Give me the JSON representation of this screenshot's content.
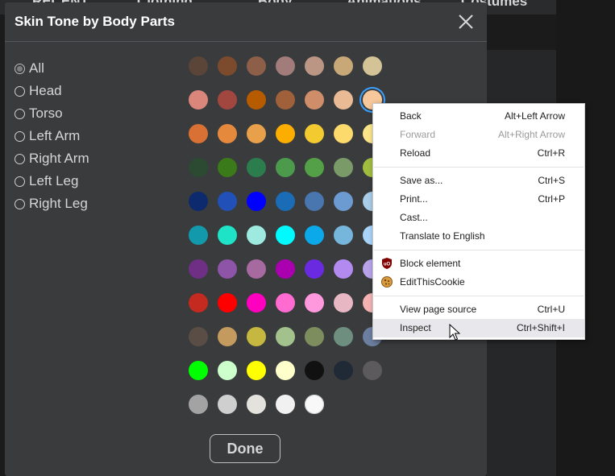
{
  "background_nav": {
    "items": [
      "RECENT",
      "Clothing",
      "Body",
      "Animations",
      "Costumes"
    ]
  },
  "modal": {
    "title": "Skin Tone by Body Parts",
    "close_icon": "close-icon",
    "radio_options": [
      {
        "label": "All",
        "checked": true
      },
      {
        "label": "Head",
        "checked": false
      },
      {
        "label": "Torso",
        "checked": false
      },
      {
        "label": "Left Arm",
        "checked": false
      },
      {
        "label": "Right Arm",
        "checked": false
      },
      {
        "label": "Left Leg",
        "checked": false
      },
      {
        "label": "Right Leg",
        "checked": false
      }
    ],
    "swatch_rows": [
      [
        "#5a4538",
        "#7c4a2d",
        "#8d5f48",
        "#a17c7a",
        "#bc9684",
        "#c9a877",
        "#d3c396"
      ],
      [
        "#da867a",
        "#a2473f",
        "#b65b00",
        "#a0603a",
        "#cf8d69",
        "#eaba94",
        "#f6c89b"
      ],
      [
        "#d97034",
        "#e58a3d",
        "#e8a04a",
        "#fcae00",
        "#f3cb31",
        "#fcda6b",
        "#fbe589"
      ],
      [
        "#2b4a31",
        "#3a7a19",
        "#2b7d4e",
        "#4c9a4c",
        "#54a047",
        "#7a9a68",
        "#a1bd40"
      ],
      [
        "#0e2a6e",
        "#2050b8",
        "#0000ff",
        "#1b6cb7",
        "#4a76b0",
        "#6c9bd2",
        "#a9cce8"
      ],
      [
        "#1299ac",
        "#1fe3c7",
        "#9ee9e0",
        "#00fbff",
        "#0ba9ea",
        "#76b6dc",
        "#a9d3f9"
      ],
      [
        "#6e2f85",
        "#8e54a8",
        "#a76aa0",
        "#ab00b0",
        "#6a2be0",
        "#b28af0",
        "#b8a3e8"
      ],
      [
        "#c42a1f",
        "#ff0000",
        "#ff00bf",
        "#ff6bd1",
        "#ff98dc",
        "#e7b8c4",
        "#f6b3b3"
      ],
      [
        "#5a4d45",
        "#c49a5e",
        "#c6b740",
        "#a3c18d",
        "#7e8d5d",
        "#6e8f7f",
        "#6c7fa0"
      ],
      [
        "#00ff00",
        "#ccffcc",
        "#ffff00",
        "#ffffcc",
        "#111111",
        "#1f2a36",
        "#5d5a5d"
      ],
      [
        "#a3a3a3",
        "#cfcfcf",
        "#e3e2dd",
        "#f1f1f1",
        "#f8f8f8"
      ]
    ],
    "selected_swatch": {
      "row": 1,
      "col": 6
    },
    "done_label": "Done"
  },
  "context_menu": {
    "items": [
      {
        "label": "Back",
        "shortcut": "Alt+Left Arrow",
        "disabled": false
      },
      {
        "label": "Forward",
        "shortcut": "Alt+Right Arrow",
        "disabled": true
      },
      {
        "label": "Reload",
        "shortcut": "Ctrl+R",
        "disabled": false
      },
      {
        "label": "Save as...",
        "shortcut": "Ctrl+S",
        "disabled": false
      },
      {
        "label": "Print...",
        "shortcut": "Ctrl+P",
        "disabled": false
      },
      {
        "label": "Cast...",
        "shortcut": "",
        "disabled": false
      },
      {
        "label": "Translate to English",
        "shortcut": "",
        "disabled": false
      },
      {
        "label": "Block element",
        "shortcut": "",
        "disabled": false,
        "icon": "ublock-origin-icon"
      },
      {
        "label": "EditThisCookie",
        "shortcut": "",
        "disabled": false,
        "icon": "cookie-icon"
      },
      {
        "label": "View page source",
        "shortcut": "Ctrl+U",
        "disabled": false
      },
      {
        "label": "Inspect",
        "shortcut": "Ctrl+Shift+I",
        "disabled": false,
        "hovered": true
      }
    ]
  }
}
